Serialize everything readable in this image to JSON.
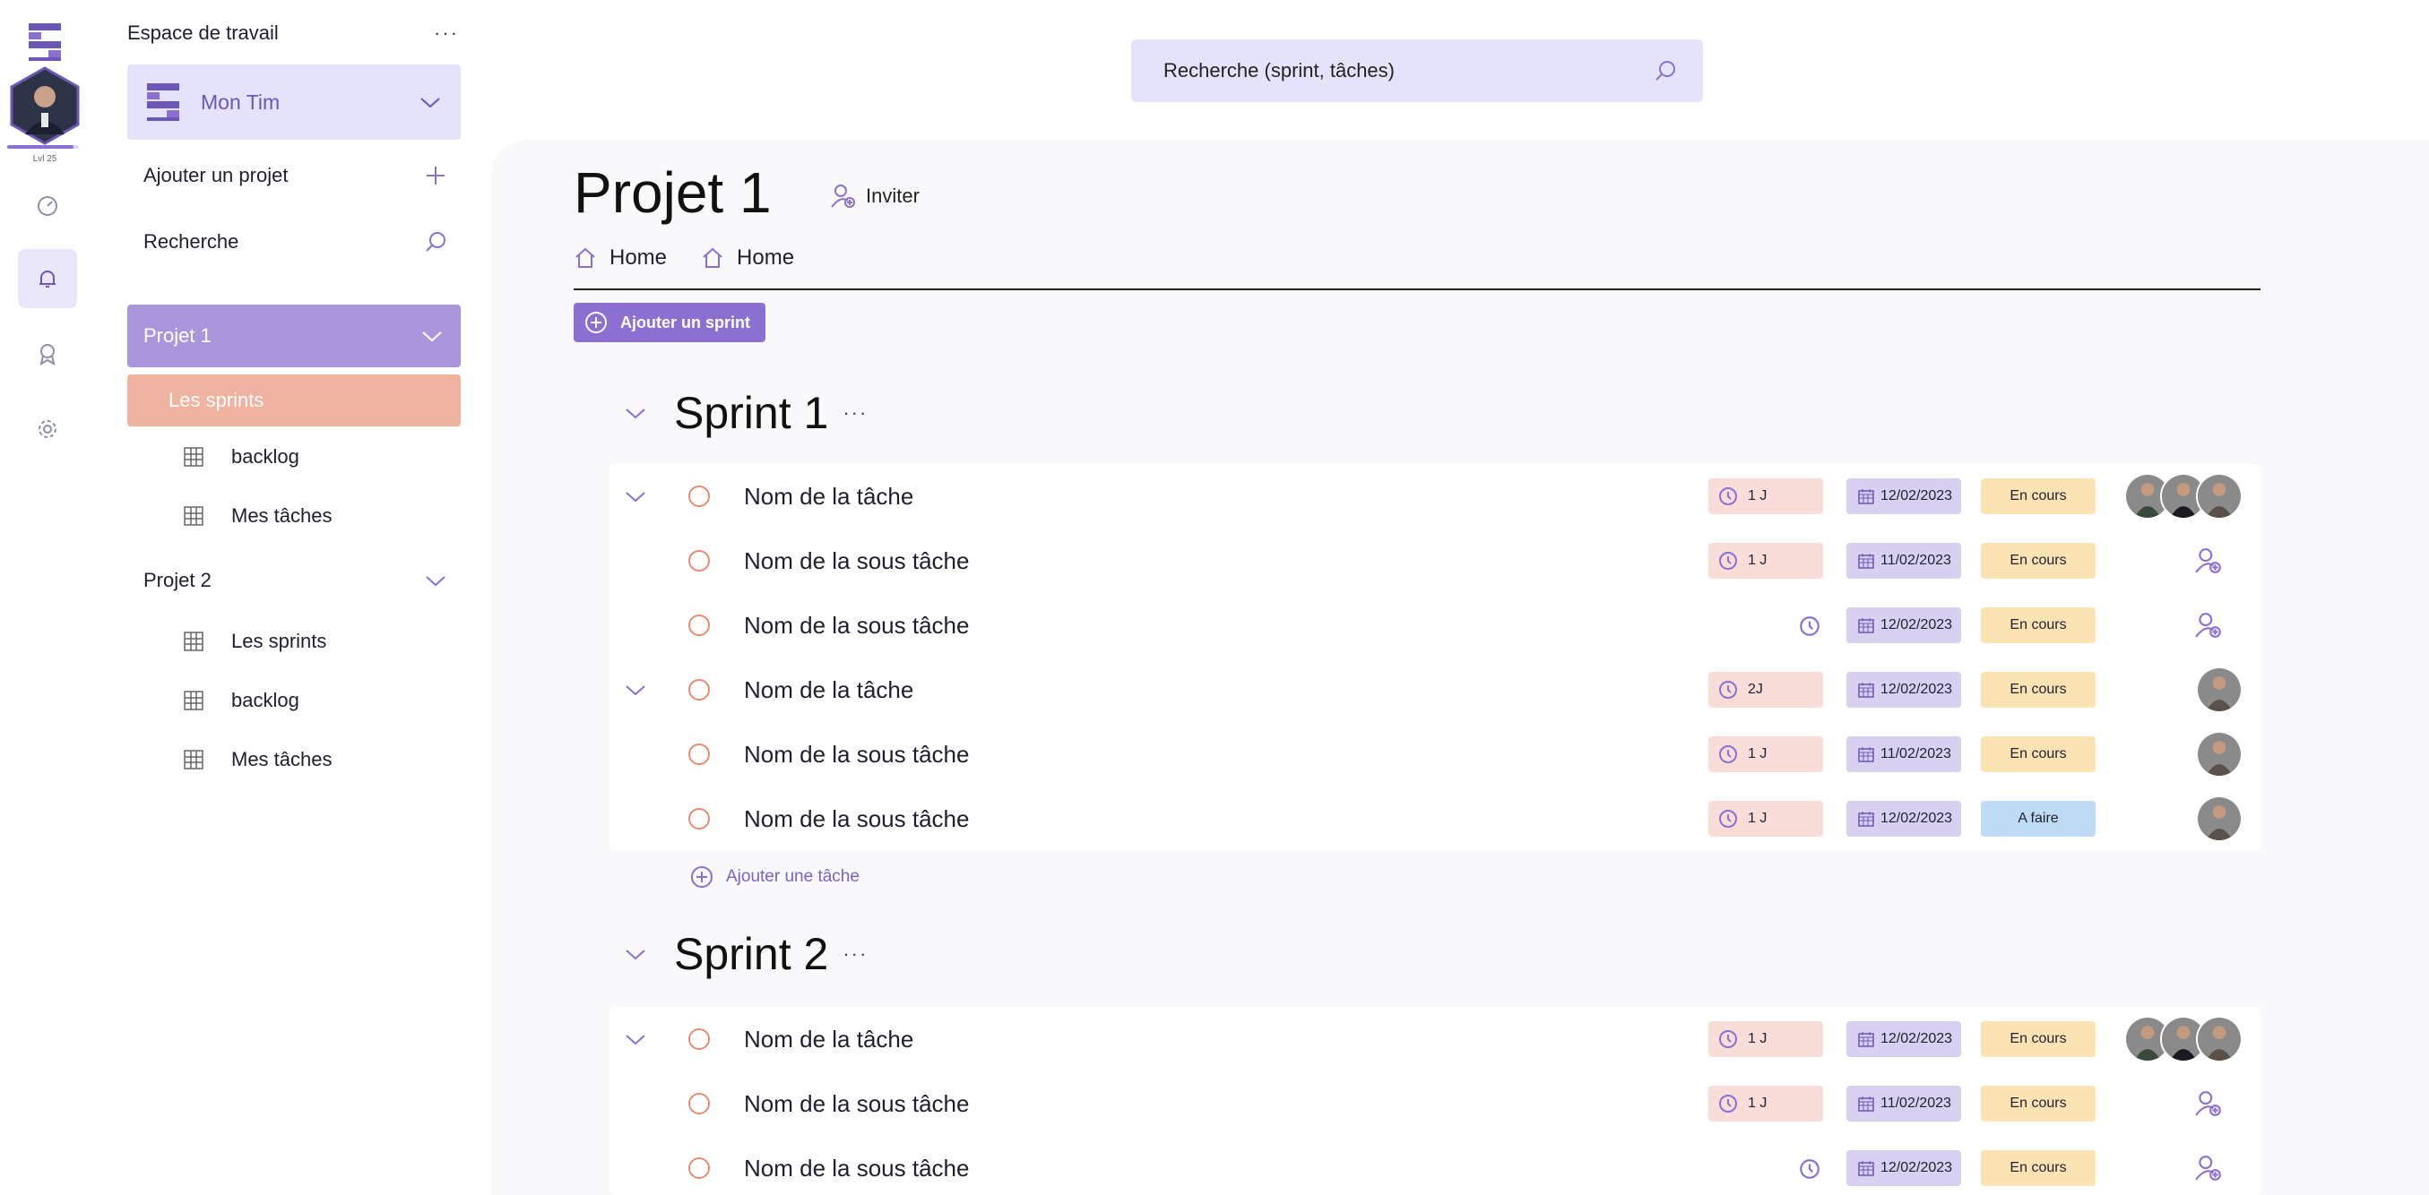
{
  "rail": {
    "logo": "workspace-logo",
    "level": "Lvl 25",
    "level_progress": 0.92,
    "items": [
      "dashboard-icon",
      "bell-icon",
      "award-icon",
      "gear-icon"
    ]
  },
  "sidebar": {
    "workspace_label": "Espace de travail",
    "team_name": "Mon Tim",
    "add_project": "Ajouter un projet",
    "search": "Recherche",
    "projects": [
      {
        "label": "Projet 1",
        "children": [
          "Les sprints",
          "backlog",
          "Mes tâches"
        ]
      },
      {
        "label": "Projet 2",
        "children": [
          "Les sprints",
          "backlog",
          "Mes tâches"
        ]
      }
    ]
  },
  "search": {
    "placeholder": "Recherche (sprint, tâches)"
  },
  "main": {
    "title": "Projet 1",
    "invite": "Inviter",
    "breadcrumbs": [
      "Home",
      "Home"
    ],
    "add_sprint": "Ajouter un sprint",
    "add_task": "Ajouter une tâche",
    "sprints": [
      {
        "name": "Sprint 1",
        "rows": [
          {
            "name": "Nom de la tâche",
            "kind": "task",
            "time": "1 J",
            "date": "12/02/2023",
            "status": "En cours",
            "avatars": 3
          },
          {
            "name": "Nom de la sous tâche",
            "kind": "sub",
            "time": "1 J",
            "date": "11/02/2023",
            "status": "En cours",
            "avatars": 0
          },
          {
            "name": "Nom de la sous tâche",
            "kind": "sub",
            "time": "",
            "date": "12/02/2023",
            "status": "En cours",
            "avatars": 0
          },
          {
            "name": "Nom de la tâche",
            "kind": "task",
            "time": "2J",
            "date": "12/02/2023",
            "status": "En cours",
            "avatars": 1
          },
          {
            "name": "Nom de la sous tâche",
            "kind": "sub",
            "time": "1 J",
            "date": "11/02/2023",
            "status": "En cours",
            "avatars": 1
          },
          {
            "name": "Nom de la sous tâche",
            "kind": "sub",
            "time": "1 J",
            "date": "12/02/2023",
            "status": "A faire",
            "avatars": 1
          }
        ]
      },
      {
        "name": "Sprint 2",
        "rows": [
          {
            "name": "Nom de la tâche",
            "kind": "task",
            "time": "1 J",
            "date": "12/02/2023",
            "status": "En cours",
            "avatars": 3
          },
          {
            "name": "Nom de la sous tâche",
            "kind": "sub",
            "time": "1 J",
            "date": "11/02/2023",
            "status": "En cours",
            "avatars": 0
          },
          {
            "name": "Nom de la sous tâche",
            "kind": "sub",
            "time": "",
            "date": "12/02/2023",
            "status": "En cours",
            "avatars": 0
          }
        ]
      }
    ]
  },
  "colors": {
    "accent": "#8b6fd1",
    "project_active": "#a897dc",
    "sprints_active": "#efb3a0",
    "time_pill": "#f9ddd8",
    "date_pill": "#d8d0f0",
    "status_en_cours": "#fbe3b4",
    "status_a_faire": "#bfdcf7"
  }
}
